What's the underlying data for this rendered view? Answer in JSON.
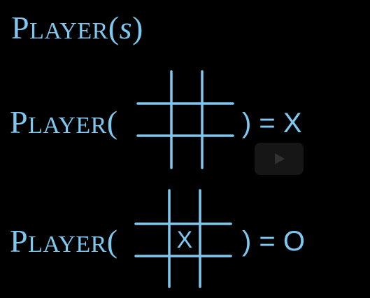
{
  "title": {
    "p_big": "P",
    "layer_small": "LAYER",
    "open_paren": "(",
    "s": "s",
    "close_paren": ")"
  },
  "row1": {
    "p_big": "P",
    "layer_small": "LAYER",
    "open_paren": "(",
    "result": ") = X"
  },
  "row2": {
    "p_big": "P",
    "layer_small": "LAYER",
    "open_paren": "(",
    "result": ") = O",
    "board_center_mark": "X"
  },
  "colors": {
    "background": "#000000",
    "accent": "#7ec8f0",
    "grid_line": "#7ec8f0",
    "play_button_bg": "#1a1a1a"
  },
  "icons": {
    "play": "play-icon"
  }
}
